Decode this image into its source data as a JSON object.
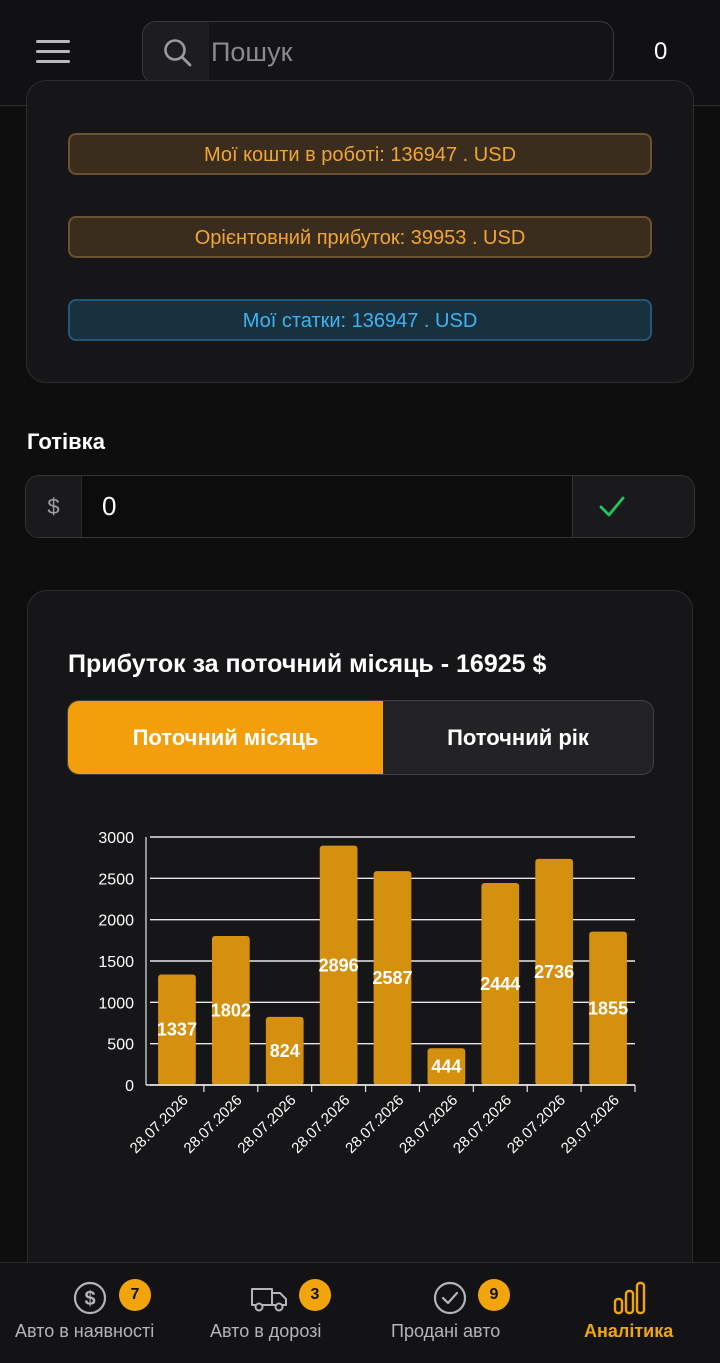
{
  "header": {
    "search_placeholder": "Пошук",
    "counter": "0"
  },
  "stats": {
    "funds": "Мої кошти в роботі: 136947 . USD",
    "profit": "Орієнтовний прибуток: 39953 . USD",
    "balance": "Мої статки: 136947 . USD"
  },
  "cash": {
    "label": "Готівка",
    "currency_symbol": "$",
    "value": "0"
  },
  "profit_section": {
    "title": "Прибуток за поточний місяць - 16925 $",
    "tabs": [
      "Поточний місяць",
      "Поточний рік"
    ]
  },
  "chart_data": {
    "type": "bar",
    "categories": [
      "28.07.2026",
      "28.07.2026",
      "28.07.2026",
      "28.07.2026",
      "28.07.2026",
      "28.07.2026",
      "28.07.2026",
      "28.07.2026",
      "29.07.2026"
    ],
    "values": [
      1337,
      1802,
      824,
      2896,
      2587,
      444,
      2444,
      2736,
      1855
    ],
    "ylim": [
      0,
      3000
    ],
    "yticks": [
      0,
      500,
      1000,
      1500,
      2000,
      2500,
      3000
    ],
    "grid": true,
    "bar_color": "#d6900f"
  },
  "bottom_nav": [
    {
      "label": "Авто в наявності",
      "badge": "7",
      "icon": "dollar-circle-icon"
    },
    {
      "label": "Авто в дорозі",
      "badge": "3",
      "icon": "truck-icon"
    },
    {
      "label": "Продані авто",
      "badge": "9",
      "icon": "check-circle-icon"
    },
    {
      "label": "Аналітика",
      "badge": "",
      "icon": "bar-chart-icon"
    }
  ],
  "colors": {
    "accent": "#f29f0b",
    "success": "#22c55e",
    "info": "#3fb3f2"
  }
}
